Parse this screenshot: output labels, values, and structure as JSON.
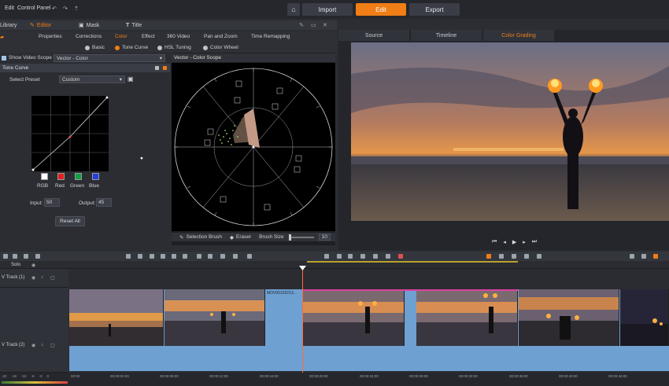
{
  "menu": {
    "items": [
      "Edit",
      "Control Panel"
    ]
  },
  "modes": {
    "home_icon": "home-icon",
    "import": "Import",
    "edit": "Edit",
    "export": "Export"
  },
  "editor_tabs": {
    "library": "Library",
    "editor": "Editor",
    "mask": "Mask",
    "title": "Title"
  },
  "editor_subtabs": [
    "Properties",
    "Corrections",
    "Color",
    "Effect",
    "360 Video",
    "Pan and Zoom",
    "Time Remapping"
  ],
  "color_modes": [
    "Basic",
    "Tone Curve",
    "HSL Tuning",
    "Color Wheel"
  ],
  "scope": {
    "show_label": "Show Video Scope",
    "selected": "Vector - Color",
    "title": "Vector - Color Scope"
  },
  "tone_curve": {
    "header": "Tone Curve",
    "preset_label": "Select Preset",
    "preset_value": "Custom",
    "channels": [
      "RGB",
      "Red",
      "Green",
      "Blue"
    ],
    "input_label": "Input:",
    "input_value": "50",
    "output_label": "Output:",
    "output_value": "45",
    "reset": "Reset All"
  },
  "scope_tools": {
    "selection_brush": "Selection Brush",
    "eraser": "Eraser",
    "brush_size_label": "Brush Size",
    "brush_size_value": "10"
  },
  "preview_tabs": [
    "Source",
    "Timeline",
    "Color Grading"
  ],
  "tracks": {
    "solo": "Solo",
    "track1": "V Track (1)",
    "track2": "V Track (2)"
  },
  "clip_label": "MOV00102213...",
  "ruler": [
    "00:00",
    "00:00:04:00",
    "00:00:08:00",
    "00:00:12:00",
    "00:00:16:00",
    "00:00:20:00",
    "00:00:24:00",
    "00:00:28:00",
    "00:00:32:00",
    "00:00:36:00",
    "00:00:40:00",
    "00:00:44:00"
  ],
  "meter": [
    "-22",
    "-16",
    "-10",
    "-6",
    "-3",
    "0"
  ],
  "colors": {
    "accent": "#f07d16",
    "timeline_clip": "#6fa0d2",
    "magenta_marker": "#e040a0"
  }
}
